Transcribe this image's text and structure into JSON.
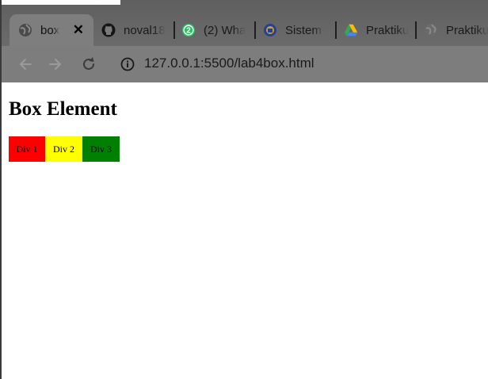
{
  "browser": {
    "tabs": [
      {
        "label": "box",
        "icon": "globe-icon",
        "active": true
      },
      {
        "label": "noval18",
        "icon": "github-icon"
      },
      {
        "label": "(2) Wha",
        "icon": "whatsapp-icon",
        "badge": "2"
      },
      {
        "label": "Sistem I",
        "icon": "university-icon"
      },
      {
        "label": "Praktiku",
        "icon": "google-drive-icon"
      },
      {
        "label": "Praktiku",
        "icon": "globe-icon"
      }
    ],
    "close_glyph": "✕",
    "url": "127.0.0.1:5500/lab4box.html",
    "colors": {
      "tab_strip": "#666666",
      "toolbar": "#7d7d7d"
    }
  },
  "page": {
    "heading": "Box Element",
    "boxes": [
      {
        "label": "Div 1",
        "color": "#ff0000"
      },
      {
        "label": "Div 2",
        "color": "#ffff00"
      },
      {
        "label": "Div 3",
        "color": "#008000"
      }
    ]
  }
}
